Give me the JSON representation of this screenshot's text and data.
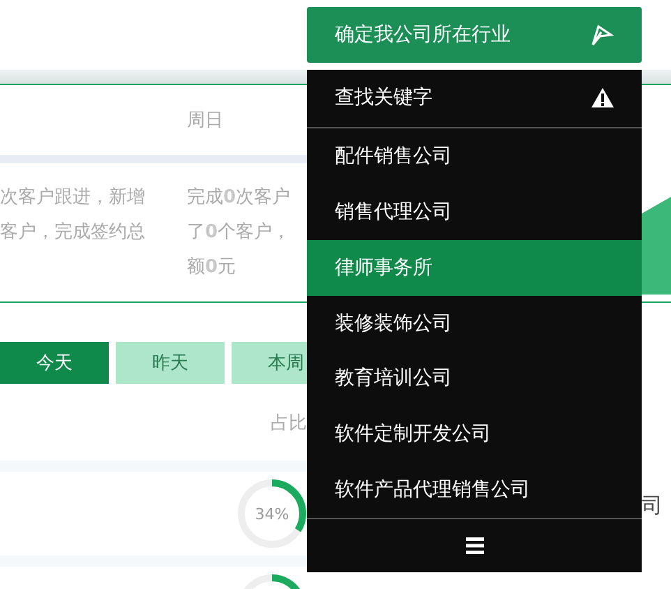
{
  "industry_button": {
    "label": "确定我公司所在行业"
  },
  "industry_menu": {
    "items": [
      {
        "label": "查找关键字",
        "kind": "search",
        "selected": false
      },
      {
        "label": "配件销售公司",
        "kind": "option",
        "selected": false
      },
      {
        "label": "销售代理公司",
        "kind": "option",
        "selected": false
      },
      {
        "label": "律师事务所",
        "kind": "option",
        "selected": true
      },
      {
        "label": "装修装饰公司",
        "kind": "option",
        "selected": false
      },
      {
        "label": "教育培训公司",
        "kind": "option",
        "selected": false
      },
      {
        "label": "软件定制开发公司",
        "kind": "option",
        "selected": false
      },
      {
        "label": "软件产品代理销售公司",
        "kind": "option",
        "selected": false
      }
    ]
  },
  "summary_card": {
    "columns": [
      {
        "lines": [
          "次客户跟进，新增",
          "客户，完成签约总"
        ]
      },
      {
        "heading": "周日",
        "lines": [
          "完成**0**次客户",
          "了**0**个客户，",
          "额**0**元"
        ]
      }
    ]
  },
  "tabs": [
    {
      "label": "今天",
      "selected": true
    },
    {
      "label": "昨天",
      "selected": false
    },
    {
      "label": "本周",
      "selected": false
    }
  ],
  "table": {
    "columns": [
      "占比"
    ],
    "rows": [
      {
        "share": "34%",
        "level": 0.34
      },
      {
        "kind": "cut_off"
      }
    ]
  },
  "right_panel": {
    "text": "司"
  }
}
